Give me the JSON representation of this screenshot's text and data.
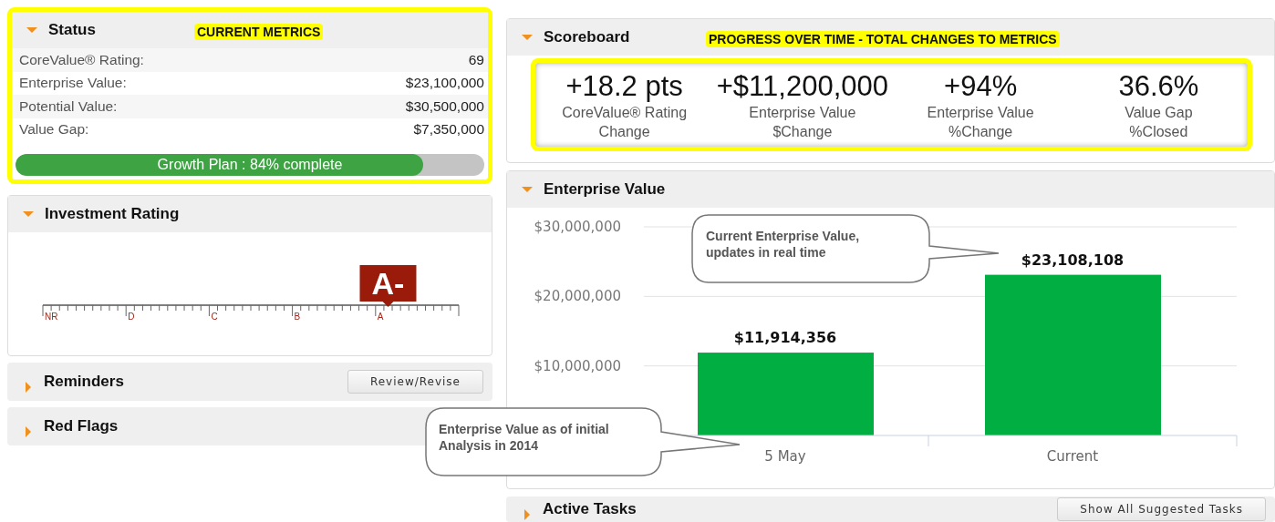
{
  "status": {
    "title": "Status",
    "expanded": true,
    "annotation": "CURRENT METRICS",
    "rows": [
      {
        "label": "CoreValue® Rating:",
        "value": "69"
      },
      {
        "label": "Enterprise Value:",
        "value": "$23,100,000"
      },
      {
        "label": "Potential Value:",
        "value": "$30,500,000"
      },
      {
        "label": "Value Gap:",
        "value": "$7,350,000"
      }
    ],
    "progress": {
      "label": "Growth Plan : 84% complete",
      "level": 0.87
    }
  },
  "investment_rating": {
    "title": "Investment Rating",
    "expanded": true,
    "scale_labels": [
      "NR",
      "D",
      "C",
      "B",
      "A"
    ],
    "rating": {
      "label": "A-",
      "level": 0.83
    }
  },
  "reminders": {
    "title": "Reminders",
    "expanded": false,
    "button": "Review/Revise"
  },
  "red_flags": {
    "title": "Red Flags",
    "expanded": false
  },
  "scoreboard": {
    "title": "Scoreboard",
    "expanded": true,
    "annotation": "PROGRESS OVER TIME - TOTAL CHANGES TO METRICS",
    "metrics": [
      {
        "value": "+18.2 pts",
        "caption": [
          "CoreValue® Rating",
          "Change"
        ]
      },
      {
        "value": "+$11,200,000",
        "caption": [
          "Enterprise Value",
          "$Change"
        ]
      },
      {
        "value": "+94%",
        "caption": [
          "Enterprise Value",
          "%Change"
        ]
      },
      {
        "value": "36.6%",
        "caption": [
          "Value Gap",
          "%Closed"
        ]
      }
    ]
  },
  "enterprise_value": {
    "title": "Enterprise Value",
    "expanded": true,
    "chart_data": {
      "type": "bar",
      "categories": [
        "5 May",
        "Current"
      ],
      "values": [
        11914356,
        23108108
      ],
      "ylim": [
        0,
        30000000
      ],
      "yticks": [
        {
          "value": 10000000,
          "label": "$10,000,000"
        },
        {
          "value": 20000000,
          "label": "$20,000,000"
        },
        {
          "value": 30000000,
          "label": "$30,000,000"
        }
      ],
      "value_labels": [
        "$11,914,356",
        "$23,108,108"
      ]
    },
    "callouts": [
      {
        "lines": [
          "Current Enterprise Value,",
          "updates in real time"
        ]
      },
      {
        "lines": [
          "Enterprise Value as of initial",
          "Analysis in 2014"
        ]
      }
    ]
  },
  "active_tasks": {
    "title": "Active Tasks",
    "expanded": false,
    "button": "Show All Suggested Tasks"
  }
}
